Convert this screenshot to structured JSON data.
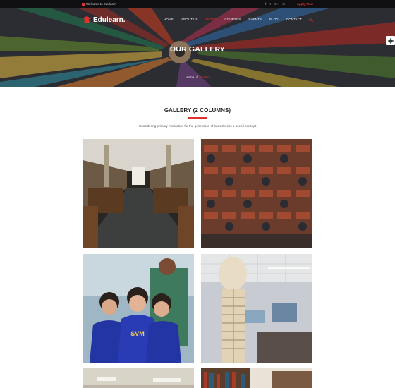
{
  "topbar": {
    "welcome": "Welcome to Edulearn",
    "social": [
      "f",
      "t",
      "G+",
      "in"
    ],
    "apply": "Apply Now"
  },
  "brand": {
    "name": "Edulearn."
  },
  "nav": {
    "items": [
      "HOME",
      "ABOUT US",
      "PAGES",
      "COURSES",
      "EVENTS",
      "BLOG",
      "CONTACT"
    ],
    "active_index": 2
  },
  "hero": {
    "title": "OUR GALLERY",
    "breadcrumb": {
      "home": "Home",
      "separator": "//",
      "current": "Gallery"
    }
  },
  "section": {
    "title": "GALLERY (2 COLUMNS)",
    "subtitle": "Considering primary motivation for the generation of narratives is a useful concept"
  },
  "gallery": {
    "items": [
      {
        "name": "library-hall"
      },
      {
        "name": "lecture-audience"
      },
      {
        "name": "students-smiling",
        "shirt_text": "SVM"
      },
      {
        "name": "skeleton-classroom"
      },
      {
        "name": "ceiling-lights"
      },
      {
        "name": "bookshelves"
      }
    ]
  },
  "colors": {
    "accent": "#e0312c",
    "topbar": "#0f0f11"
  }
}
